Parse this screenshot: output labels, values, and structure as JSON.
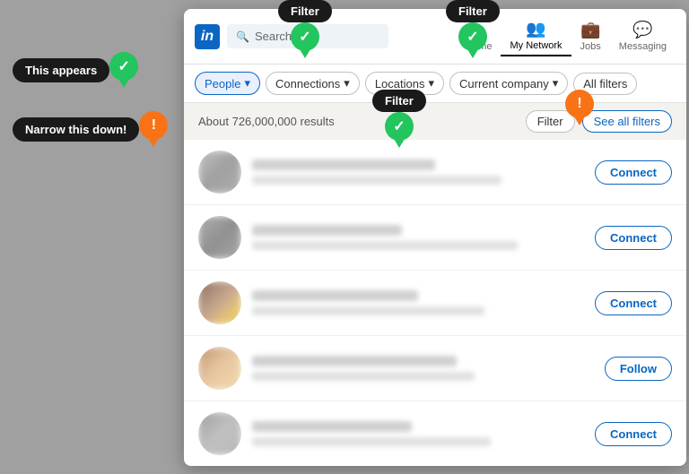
{
  "linkedin": {
    "logo_text": "in",
    "search_placeholder": "Search",
    "nav_items": [
      {
        "id": "home",
        "label": "Home",
        "icon": "⌂"
      },
      {
        "id": "my-network",
        "label": "My Network",
        "icon": "👥"
      },
      {
        "id": "jobs",
        "label": "Jobs",
        "icon": "💼"
      },
      {
        "id": "messaging",
        "label": "Messaging",
        "icon": "💬"
      }
    ],
    "filter_bar": {
      "people_label": "People",
      "connections_label": "Connections",
      "locations_label": "Locations",
      "current_company_label": "Current company",
      "all_filters_label": "All filters"
    },
    "results_bar": {
      "count_text": "About 726,000,000 results",
      "filter_label": "Filter",
      "see_all_label": "See all filters"
    },
    "people": [
      {
        "id": 1,
        "action": "Connect",
        "name_width": "55%",
        "title_width": "75%"
      },
      {
        "id": 2,
        "action": "Connect",
        "name_width": "45%",
        "title_width": "80%"
      },
      {
        "id": 3,
        "action": "Connect",
        "name_width": "50%",
        "title_width": "70%"
      },
      {
        "id": 4,
        "action": "Follow",
        "name_width": "60%",
        "title_width": "65%"
      },
      {
        "id": 5,
        "action": "Connect",
        "name_width": "48%",
        "title_width": "72%"
      }
    ]
  },
  "annotations": {
    "this_appears": "This appears",
    "narrow_this_down": "Narrow this down!",
    "filter_label": "Filter",
    "checkmark": "✓",
    "exclaim": "!"
  }
}
